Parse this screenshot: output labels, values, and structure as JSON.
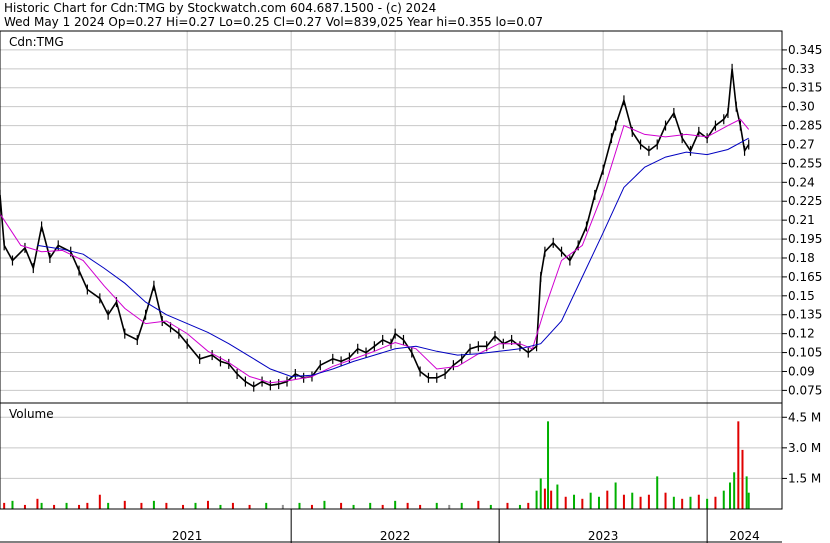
{
  "header": {
    "line1": "Historic Chart for Cdn:TMG by Stockwatch.com 604.687.1500 - (c) 2024",
    "line2": "Wed May  1 2024  Op=0.27  Hi=0.27  Lo=0.25  Cl=0.27  Vol=839,025  Year hi=0.355  lo=0.07"
  },
  "colors": {
    "grid": "#c8c8c8",
    "price": "#000000",
    "ma_short": "#d000d0",
    "ma_long": "#0000c0",
    "vol_up": "#00b000",
    "vol_down": "#e00000",
    "vol_flat": "#909090"
  },
  "chart_data": [
    {
      "type": "line",
      "title": "Cdn:TMG",
      "ylim": [
        0.065,
        0.36
      ],
      "y_ticks": [
        "0.075",
        "0.09",
        "0.105",
        "0.12",
        "0.135",
        "0.15",
        "0.165",
        "0.18",
        "0.195",
        "0.21",
        "0.225",
        "0.24",
        "0.255",
        "0.27",
        "0.285",
        "0.30",
        "0.315",
        "0.33",
        "0.345"
      ],
      "x_axis": {
        "labels": [
          "2021",
          "2022",
          "2023",
          "2024"
        ],
        "range": [
          2020.6,
          2024.36
        ]
      },
      "series": [
        {
          "key": "close",
          "style": "ohlc",
          "values": [
            [
              2020.6,
              0.23
            ],
            [
              2020.62,
              0.19
            ],
            [
              2020.66,
              0.178
            ],
            [
              2020.72,
              0.188
            ],
            [
              2020.76,
              0.172
            ],
            [
              2020.8,
              0.205
            ],
            [
              2020.84,
              0.18
            ],
            [
              2020.88,
              0.19
            ],
            [
              2020.94,
              0.185
            ],
            [
              2020.98,
              0.17
            ],
            [
              2021.02,
              0.155
            ],
            [
              2021.08,
              0.148
            ],
            [
              2021.12,
              0.135
            ],
            [
              2021.16,
              0.145
            ],
            [
              2021.2,
              0.12
            ],
            [
              2021.26,
              0.115
            ],
            [
              2021.3,
              0.135
            ],
            [
              2021.34,
              0.158
            ],
            [
              2021.38,
              0.13
            ],
            [
              2021.42,
              0.125
            ],
            [
              2021.46,
              0.12
            ],
            [
              2021.5,
              0.112
            ],
            [
              2021.56,
              0.1
            ],
            [
              2021.62,
              0.103
            ],
            [
              2021.66,
              0.098
            ],
            [
              2021.7,
              0.096
            ],
            [
              2021.74,
              0.088
            ],
            [
              2021.78,
              0.082
            ],
            [
              2021.82,
              0.078
            ],
            [
              2021.86,
              0.082
            ],
            [
              2021.9,
              0.079
            ],
            [
              2021.94,
              0.08
            ],
            [
              2021.98,
              0.082
            ],
            [
              2022.02,
              0.088
            ],
            [
              2022.06,
              0.085
            ],
            [
              2022.1,
              0.086
            ],
            [
              2022.14,
              0.095
            ],
            [
              2022.2,
              0.1
            ],
            [
              2022.24,
              0.098
            ],
            [
              2022.28,
              0.101
            ],
            [
              2022.32,
              0.108
            ],
            [
              2022.36,
              0.105
            ],
            [
              2022.4,
              0.11
            ],
            [
              2022.44,
              0.115
            ],
            [
              2022.48,
              0.112
            ],
            [
              2022.5,
              0.12
            ],
            [
              2022.54,
              0.115
            ],
            [
              2022.58,
              0.105
            ],
            [
              2022.62,
              0.09
            ],
            [
              2022.66,
              0.085
            ],
            [
              2022.7,
              0.085
            ],
            [
              2022.74,
              0.088
            ],
            [
              2022.78,
              0.095
            ],
            [
              2022.82,
              0.1
            ],
            [
              2022.86,
              0.108
            ],
            [
              2022.9,
              0.11
            ],
            [
              2022.94,
              0.11
            ],
            [
              2022.98,
              0.118
            ],
            [
              2023.02,
              0.112
            ],
            [
              2023.06,
              0.115
            ],
            [
              2023.1,
              0.11
            ],
            [
              2023.14,
              0.105
            ],
            [
              2023.18,
              0.11
            ],
            [
              2023.2,
              0.165
            ],
            [
              2023.22,
              0.185
            ],
            [
              2023.26,
              0.192
            ],
            [
              2023.3,
              0.185
            ],
            [
              2023.34,
              0.178
            ],
            [
              2023.38,
              0.19
            ],
            [
              2023.42,
              0.205
            ],
            [
              2023.46,
              0.23
            ],
            [
              2023.5,
              0.25
            ],
            [
              2023.54,
              0.275
            ],
            [
              2023.56,
              0.285
            ],
            [
              2023.6,
              0.305
            ],
            [
              2023.64,
              0.28
            ],
            [
              2023.68,
              0.27
            ],
            [
              2023.72,
              0.265
            ],
            [
              2023.76,
              0.27
            ],
            [
              2023.8,
              0.285
            ],
            [
              2023.84,
              0.295
            ],
            [
              2023.88,
              0.275
            ],
            [
              2023.92,
              0.265
            ],
            [
              2023.96,
              0.28
            ],
            [
              2024.0,
              0.275
            ],
            [
              2024.04,
              0.285
            ],
            [
              2024.08,
              0.29
            ],
            [
              2024.1,
              0.295
            ],
            [
              2024.12,
              0.33
            ],
            [
              2024.14,
              0.3
            ],
            [
              2024.16,
              0.285
            ],
            [
              2024.18,
              0.265
            ],
            [
              2024.2,
              0.27
            ]
          ]
        },
        {
          "key": "ma_short",
          "values": [
            [
              2020.6,
              0.215
            ],
            [
              2020.7,
              0.19
            ],
            [
              2020.8,
              0.185
            ],
            [
              2020.9,
              0.186
            ],
            [
              2021.0,
              0.178
            ],
            [
              2021.1,
              0.158
            ],
            [
              2021.2,
              0.14
            ],
            [
              2021.3,
              0.128
            ],
            [
              2021.4,
              0.13
            ],
            [
              2021.5,
              0.12
            ],
            [
              2021.6,
              0.106
            ],
            [
              2021.7,
              0.097
            ],
            [
              2021.8,
              0.086
            ],
            [
              2021.9,
              0.081
            ],
            [
              2022.0,
              0.083
            ],
            [
              2022.1,
              0.086
            ],
            [
              2022.2,
              0.094
            ],
            [
              2022.3,
              0.1
            ],
            [
              2022.4,
              0.106
            ],
            [
              2022.5,
              0.113
            ],
            [
              2022.6,
              0.108
            ],
            [
              2022.7,
              0.092
            ],
            [
              2022.8,
              0.094
            ],
            [
              2022.9,
              0.104
            ],
            [
              2023.0,
              0.112
            ],
            [
              2023.1,
              0.112
            ],
            [
              2023.16,
              0.108
            ],
            [
              2023.22,
              0.14
            ],
            [
              2023.3,
              0.178
            ],
            [
              2023.4,
              0.19
            ],
            [
              2023.5,
              0.232
            ],
            [
              2023.6,
              0.285
            ],
            [
              2023.7,
              0.278
            ],
            [
              2023.8,
              0.276
            ],
            [
              2023.9,
              0.278
            ],
            [
              2024.0,
              0.276
            ],
            [
              2024.1,
              0.285
            ],
            [
              2024.16,
              0.29
            ],
            [
              2024.2,
              0.282
            ]
          ]
        },
        {
          "key": "ma_long",
          "values": [
            [
              2020.78,
              0.19
            ],
            [
              2020.9,
              0.187
            ],
            [
              2021.0,
              0.183
            ],
            [
              2021.1,
              0.172
            ],
            [
              2021.2,
              0.16
            ],
            [
              2021.3,
              0.145
            ],
            [
              2021.4,
              0.135
            ],
            [
              2021.5,
              0.128
            ],
            [
              2021.6,
              0.121
            ],
            [
              2021.7,
              0.112
            ],
            [
              2021.8,
              0.102
            ],
            [
              2021.9,
              0.092
            ],
            [
              2022.0,
              0.086
            ],
            [
              2022.1,
              0.087
            ],
            [
              2022.2,
              0.092
            ],
            [
              2022.3,
              0.098
            ],
            [
              2022.4,
              0.103
            ],
            [
              2022.5,
              0.108
            ],
            [
              2022.6,
              0.11
            ],
            [
              2022.7,
              0.106
            ],
            [
              2022.8,
              0.103
            ],
            [
              2022.9,
              0.104
            ],
            [
              2023.0,
              0.106
            ],
            [
              2023.1,
              0.108
            ],
            [
              2023.2,
              0.112
            ],
            [
              2023.3,
              0.13
            ],
            [
              2023.4,
              0.165
            ],
            [
              2023.5,
              0.2
            ],
            [
              2023.6,
              0.236
            ],
            [
              2023.7,
              0.252
            ],
            [
              2023.8,
              0.26
            ],
            [
              2023.9,
              0.264
            ],
            [
              2024.0,
              0.262
            ],
            [
              2024.1,
              0.266
            ],
            [
              2024.2,
              0.275
            ]
          ]
        }
      ]
    },
    {
      "type": "bar",
      "title": "Volume",
      "ylim": [
        0,
        5.2
      ],
      "y_ticks": [
        "1.5 M",
        "3.0 M",
        "4.5 M"
      ],
      "unit": "M shares",
      "values": [
        [
          2020.62,
          0.3,
          "d"
        ],
        [
          2020.66,
          0.4,
          "u"
        ],
        [
          2020.72,
          0.2,
          "d"
        ],
        [
          2020.78,
          0.5,
          "d"
        ],
        [
          2020.8,
          0.3,
          "u"
        ],
        [
          2020.86,
          0.2,
          "d"
        ],
        [
          2020.92,
          0.3,
          "u"
        ],
        [
          2020.98,
          0.2,
          "d"
        ],
        [
          2021.02,
          0.3,
          "d"
        ],
        [
          2021.08,
          0.7,
          "d"
        ],
        [
          2021.12,
          0.3,
          "u"
        ],
        [
          2021.2,
          0.4,
          "d"
        ],
        [
          2021.28,
          0.3,
          "d"
        ],
        [
          2021.34,
          0.4,
          "u"
        ],
        [
          2021.4,
          0.3,
          "d"
        ],
        [
          2021.48,
          0.2,
          "d"
        ],
        [
          2021.54,
          0.3,
          "u"
        ],
        [
          2021.6,
          0.4,
          "d"
        ],
        [
          2021.66,
          0.2,
          "u"
        ],
        [
          2021.72,
          0.3,
          "d"
        ],
        [
          2021.8,
          0.2,
          "d"
        ],
        [
          2021.88,
          0.3,
          "u"
        ],
        [
          2021.96,
          0.2,
          "f"
        ],
        [
          2022.04,
          0.3,
          "u"
        ],
        [
          2022.1,
          0.2,
          "d"
        ],
        [
          2022.16,
          0.4,
          "u"
        ],
        [
          2022.24,
          0.3,
          "d"
        ],
        [
          2022.3,
          0.2,
          "u"
        ],
        [
          2022.38,
          0.3,
          "u"
        ],
        [
          2022.44,
          0.2,
          "d"
        ],
        [
          2022.5,
          0.4,
          "u"
        ],
        [
          2022.56,
          0.3,
          "d"
        ],
        [
          2022.62,
          0.2,
          "d"
        ],
        [
          2022.7,
          0.3,
          "u"
        ],
        [
          2022.76,
          0.2,
          "f"
        ],
        [
          2022.82,
          0.3,
          "u"
        ],
        [
          2022.9,
          0.4,
          "d"
        ],
        [
          2022.96,
          0.2,
          "u"
        ],
        [
          2023.04,
          0.3,
          "d"
        ],
        [
          2023.1,
          0.2,
          "u"
        ],
        [
          2023.14,
          0.3,
          "d"
        ],
        [
          2023.18,
          0.9,
          "u"
        ],
        [
          2023.2,
          1.5,
          "u"
        ],
        [
          2023.22,
          1.0,
          "d"
        ],
        [
          2023.235,
          4.3,
          "u"
        ],
        [
          2023.25,
          0.9,
          "d"
        ],
        [
          2023.28,
          1.2,
          "u"
        ],
        [
          2023.32,
          0.6,
          "d"
        ],
        [
          2023.36,
          0.7,
          "u"
        ],
        [
          2023.4,
          0.5,
          "d"
        ],
        [
          2023.44,
          0.8,
          "u"
        ],
        [
          2023.48,
          0.6,
          "u"
        ],
        [
          2023.52,
          0.9,
          "d"
        ],
        [
          2023.56,
          1.3,
          "u"
        ],
        [
          2023.6,
          0.7,
          "d"
        ],
        [
          2023.64,
          0.8,
          "u"
        ],
        [
          2023.68,
          0.6,
          "d"
        ],
        [
          2023.72,
          0.7,
          "d"
        ],
        [
          2023.76,
          1.6,
          "u"
        ],
        [
          2023.8,
          0.8,
          "d"
        ],
        [
          2023.84,
          0.6,
          "u"
        ],
        [
          2023.88,
          0.5,
          "d"
        ],
        [
          2023.92,
          0.6,
          "u"
        ],
        [
          2023.96,
          0.7,
          "d"
        ],
        [
          2024.0,
          0.5,
          "u"
        ],
        [
          2024.04,
          0.6,
          "d"
        ],
        [
          2024.08,
          0.9,
          "u"
        ],
        [
          2024.11,
          1.3,
          "u"
        ],
        [
          2024.13,
          1.8,
          "u"
        ],
        [
          2024.15,
          4.3,
          "d"
        ],
        [
          2024.17,
          2.9,
          "d"
        ],
        [
          2024.19,
          1.6,
          "u"
        ],
        [
          2024.2,
          0.8,
          "u"
        ]
      ]
    }
  ]
}
